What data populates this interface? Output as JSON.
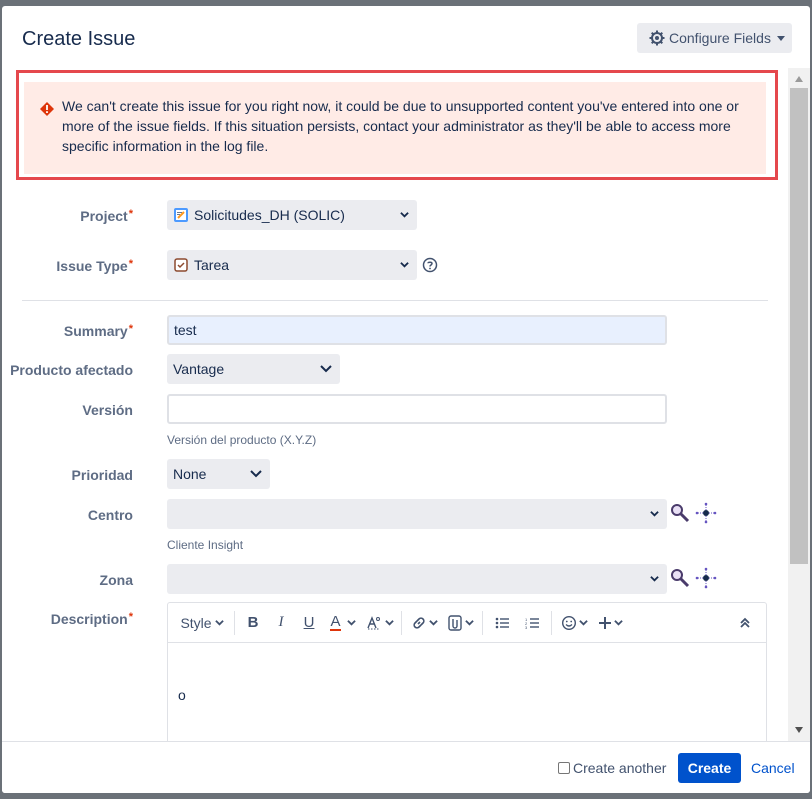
{
  "dialog": {
    "title": "Create Issue",
    "configure_label": "Configure Fields"
  },
  "error": {
    "message": "We can't create this issue for you right now, it could be due to unsupported content you've entered into one or more of the issue fields. If this situation persists, contact your administrator as they'll be able to access more specific information in the log file."
  },
  "fields": {
    "project": {
      "label": "Project",
      "required": "*",
      "value": "Solicitudes_DH (SOLIC)"
    },
    "issue_type": {
      "label": "Issue Type",
      "required": "*",
      "value": "Tarea"
    },
    "summary": {
      "label": "Summary",
      "required": "*",
      "value": "test"
    },
    "producto": {
      "label": "Producto afectado",
      "value": "Vantage"
    },
    "version": {
      "label": "Versión",
      "value": "",
      "hint": "Versión del producto (X.Y.Z)"
    },
    "prioridad": {
      "label": "Prioridad",
      "value": "None"
    },
    "centro": {
      "label": "Centro",
      "value": "",
      "hint": "Cliente Insight"
    },
    "zona": {
      "label": "Zona",
      "value": ""
    },
    "description": {
      "label": "Description",
      "required": "*",
      "value": "o"
    }
  },
  "editor_toolbar": {
    "style_label": "Style",
    "bold": "B",
    "italic": "I",
    "underline": "U",
    "color": "A"
  },
  "footer": {
    "create_another": "Create another",
    "create": "Create",
    "cancel": "Cancel"
  },
  "colors": {
    "primary": "#0052cc",
    "error_bg": "#ffebe6",
    "error_icon": "#de350b",
    "highlight": "#e5484d"
  },
  "icons": {
    "gear": "gear-icon",
    "error": "error-icon",
    "project": "project-avatar-icon",
    "issue_type": "task-icon",
    "help": "help-icon",
    "search": "search-icon",
    "graph": "graph-icon"
  }
}
